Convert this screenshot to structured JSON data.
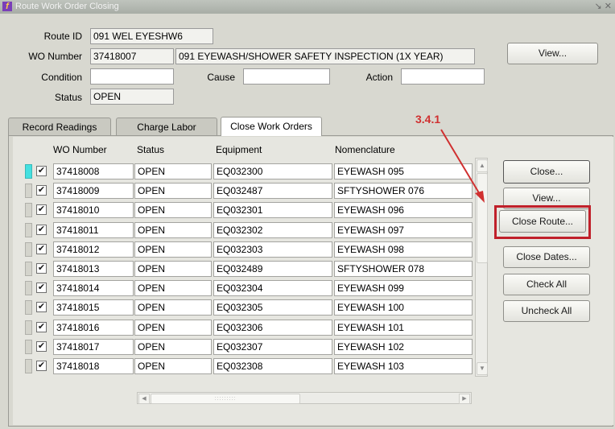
{
  "window": {
    "title": "Route Work Order Closing",
    "controls": "↘ ✕"
  },
  "header": {
    "route_id_label": "Route ID",
    "route_id_value": "091 WEL EYESHW6",
    "wo_number_label": "WO Number",
    "wo_number_value": "37418007",
    "wo_description": "091 EYEWASH/SHOWER SAFETY INSPECTION (1X YEAR)",
    "condition_label": "Condition",
    "condition_value": "",
    "cause_label": "Cause",
    "cause_value": "",
    "action_label": "Action",
    "action_value": "",
    "status_label": "Status",
    "status_value": "OPEN",
    "view_button": "View..."
  },
  "tabs": [
    {
      "label": "Record Readings",
      "active": false
    },
    {
      "label": "Charge Labor",
      "active": false
    },
    {
      "label": "Close Work Orders",
      "active": true
    }
  ],
  "table": {
    "columns": [
      "WO Number",
      "Status",
      "Equipment",
      "Nomenclature"
    ],
    "rows": [
      {
        "checked": true,
        "wo": "37418008",
        "status": "OPEN",
        "equipment": "EQ032300",
        "nomenclature": "EYEWASH 095"
      },
      {
        "checked": true,
        "wo": "37418009",
        "status": "OPEN",
        "equipment": "EQ032487",
        "nomenclature": "SFTYSHOWER 076"
      },
      {
        "checked": true,
        "wo": "37418010",
        "status": "OPEN",
        "equipment": "EQ032301",
        "nomenclature": "EYEWASH 096"
      },
      {
        "checked": true,
        "wo": "37418011",
        "status": "OPEN",
        "equipment": "EQ032302",
        "nomenclature": "EYEWASH 097"
      },
      {
        "checked": true,
        "wo": "37418012",
        "status": "OPEN",
        "equipment": "EQ032303",
        "nomenclature": "EYEWASH 098"
      },
      {
        "checked": true,
        "wo": "37418013",
        "status": "OPEN",
        "equipment": "EQ032489",
        "nomenclature": "SFTYSHOWER 078"
      },
      {
        "checked": true,
        "wo": "37418014",
        "status": "OPEN",
        "equipment": "EQ032304",
        "nomenclature": "EYEWASH 099"
      },
      {
        "checked": true,
        "wo": "37418015",
        "status": "OPEN",
        "equipment": "EQ032305",
        "nomenclature": "EYEWASH 100"
      },
      {
        "checked": true,
        "wo": "37418016",
        "status": "OPEN",
        "equipment": "EQ032306",
        "nomenclature": "EYEWASH 101"
      },
      {
        "checked": true,
        "wo": "37418017",
        "status": "OPEN",
        "equipment": "EQ032307",
        "nomenclature": "EYEWASH 102"
      },
      {
        "checked": true,
        "wo": "37418018",
        "status": "OPEN",
        "equipment": "EQ032308",
        "nomenclature": "EYEWASH 103"
      }
    ]
  },
  "side_buttons": {
    "close": "Close...",
    "view": "View...",
    "close_route": "Close Route...",
    "close_dates": "Close Dates...",
    "check_all": "Check All",
    "uncheck_all": "Uncheck All"
  },
  "annotation": {
    "label": "3.4.1",
    "color": "#d03030"
  },
  "colors": {
    "current_row_indicator": "#44e0e0",
    "highlight": "#c0202a"
  }
}
